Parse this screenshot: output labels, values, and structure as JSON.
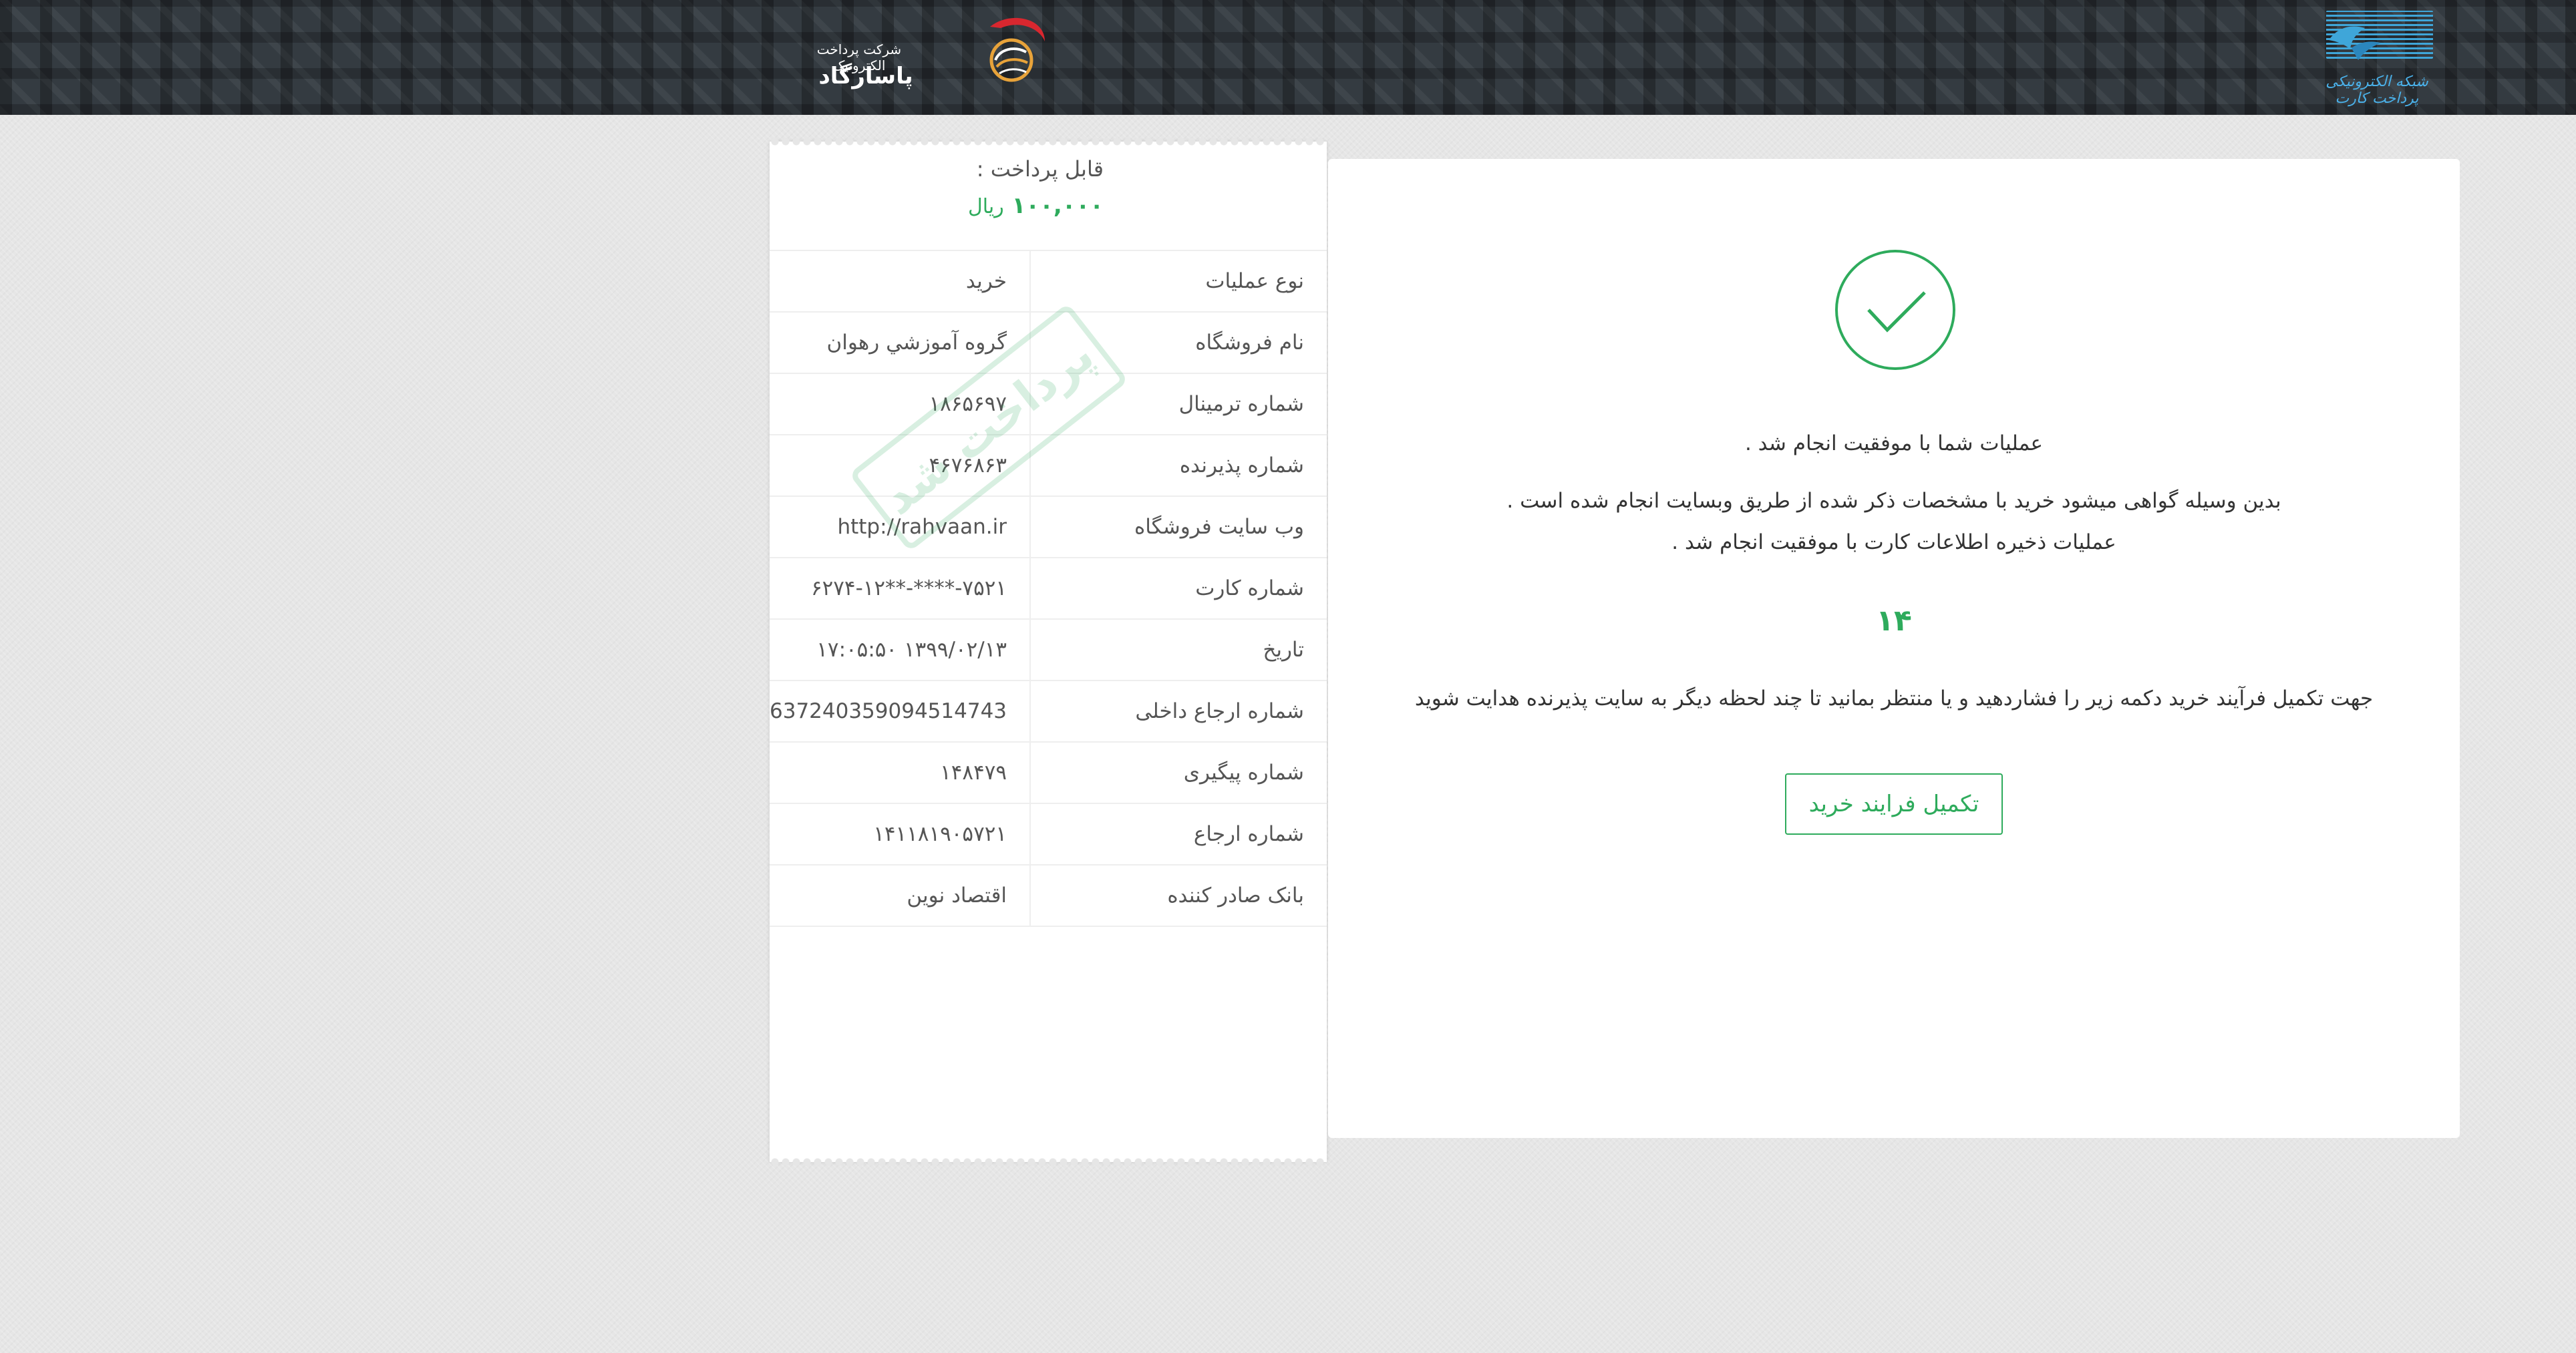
{
  "header": {
    "shaparak_logo_text": "شبکه الکترونیکی پرداخت کارت",
    "pasargad_subtitle": "شرکت پرداخت الکترونیک",
    "pasargad_name": "پاسارگاد",
    "background_color": "#343b41"
  },
  "receipt": {
    "payable_label": "قابل پرداخت :",
    "payable_amount": "۱۰۰,۰۰۰",
    "payable_unit": "ریال",
    "stamp_text": "پرداخت شد",
    "rows": [
      {
        "label": "نوع عملیات",
        "value": "خرید"
      },
      {
        "label": "نام فروشگاه",
        "value": "گروه آموزشي رهوان"
      },
      {
        "label": "شماره ترمینال",
        "value": "۱۸۶۵۶۹۷"
      },
      {
        "label": "شماره پذیرنده",
        "value": "۴۶۷۶۸۶۳"
      },
      {
        "label": "وب سایت فروشگاه",
        "value": "http://rahvaan.ir"
      },
      {
        "label": "شماره کارت",
        "value": "۶۲۷۴-۱۲**-****-۷۵۲۱"
      },
      {
        "label": "تاریخ",
        "value": "۱۳۹۹/۰۲/۱۳ ۱۷:۰۵:۵۰"
      },
      {
        "label": "شماره ارجاع داخلی",
        "value": "637240359094514743"
      },
      {
        "label": "شماره پیگیری",
        "value": "۱۴۸۴۷۹"
      },
      {
        "label": "شماره ارجاع",
        "value": "۱۴۱۱۸۱۹۰۵۷۲۱"
      },
      {
        "label": "بانک صادر کننده",
        "value": "اقتصاد نوین"
      }
    ]
  },
  "main": {
    "success_icon": "check-circle-icon",
    "message_1": "عملیات شما با موفقیت انجام شد .",
    "message_2": "بدین وسیله گواهی میشود خرید با مشخصات ذکر شده از طریق وبسایت انجام شده است .",
    "message_3": "عملیات ذخیره اطلاعات کارت با موفقیت انجام شد .",
    "countdown": "۱۴",
    "message_4": "جهت تکمیل فرآیند خرید دکمه زیر را فشاردهید و یا منتظر بمانید تا چند لحظه دیگر به سایت پذیرنده هدایت شوید",
    "complete_button_label": "تکمیل فرایند خرید"
  },
  "colors": {
    "accent_green": "#2eab5c",
    "page_background": "#e6e6e6"
  }
}
